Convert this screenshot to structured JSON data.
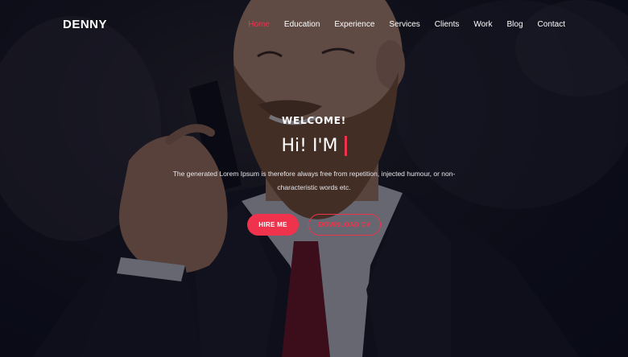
{
  "header": {
    "brand": "DENNY",
    "nav": [
      {
        "label": "Home",
        "active": true
      },
      {
        "label": "Education",
        "active": false
      },
      {
        "label": "Experience",
        "active": false
      },
      {
        "label": "Services",
        "active": false
      },
      {
        "label": "Clients",
        "active": false
      },
      {
        "label": "Work",
        "active": false
      },
      {
        "label": "Blog",
        "active": false
      },
      {
        "label": "Contact",
        "active": false
      }
    ]
  },
  "hero": {
    "welcome": "WELCOME!",
    "headline": "Hi! I'M",
    "description": "The generated Lorem Ipsum is therefore always free from repetition, injected humour, or non-characteristic words etc.",
    "buttons": {
      "hire": "HIRE ME",
      "download": "DOWNLOAD CV"
    }
  },
  "colors": {
    "accent": "#f0334d",
    "overlay": "#0a0b18",
    "text": "#ffffff"
  }
}
